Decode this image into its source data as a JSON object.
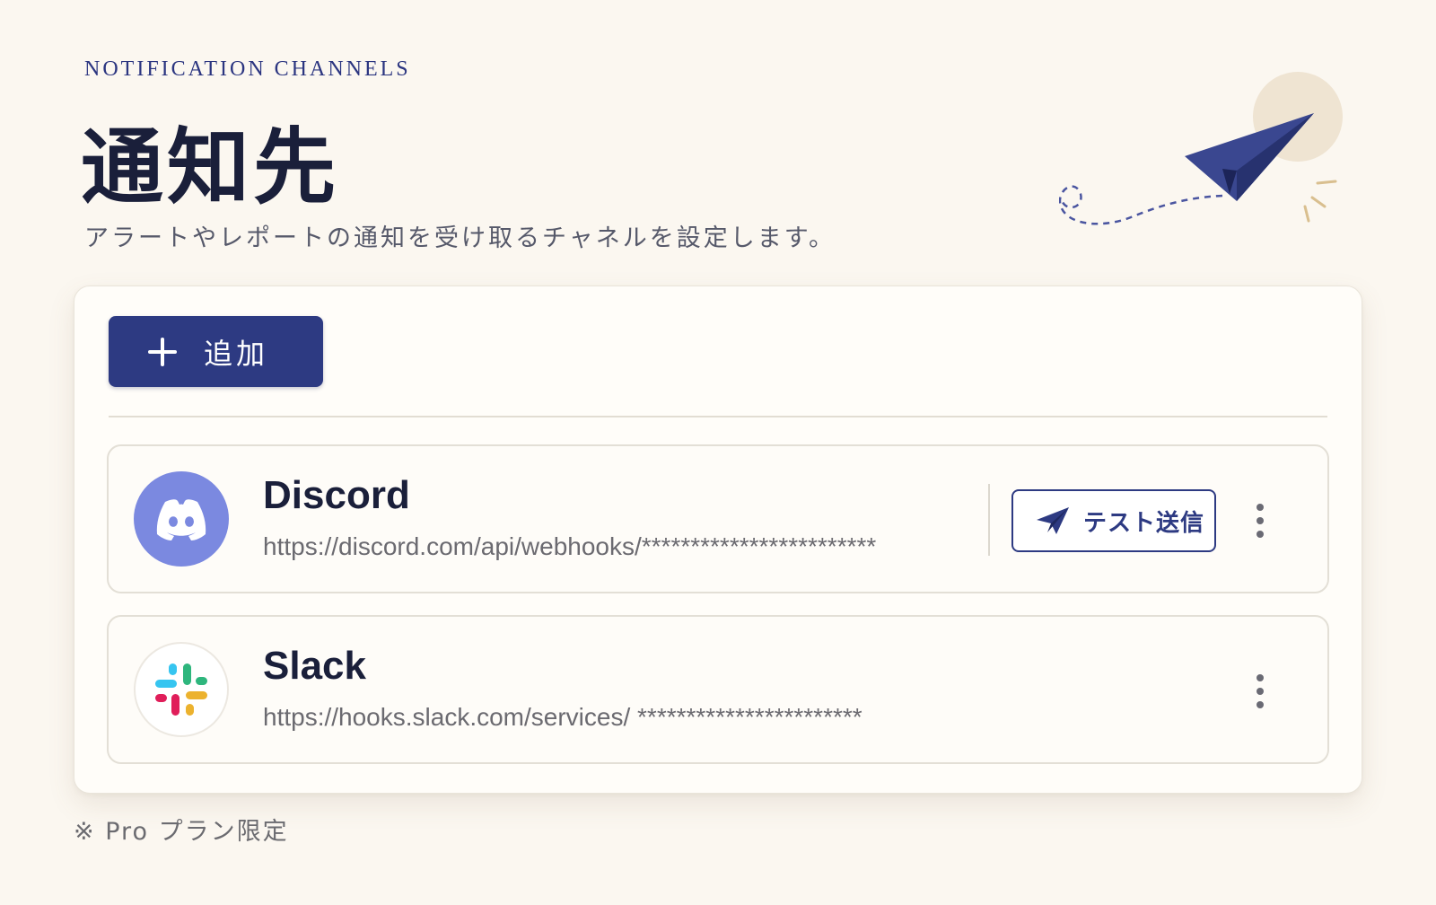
{
  "header": {
    "eyebrow": "NOTIFICATION CHANNELS",
    "title": "通知先",
    "subtitle": "アラートやレポートの通知を受け取るチャネルを設定します。"
  },
  "toolbar": {
    "add_label": "追加"
  },
  "channels": [
    {
      "name": "Discord",
      "url": "https://discord.com/api/webhooks/************************",
      "icon": "discord-logo",
      "test_label": "テスト送信"
    },
    {
      "name": "Slack",
      "url": "https://hooks.slack.com/services/ ***********************",
      "icon": "slack-logo"
    }
  ],
  "footer": {
    "note": "※ Pro プラン限定"
  },
  "colors": {
    "accent": "#2d3a82",
    "background": "#fbf7f0",
    "discord": "#7b89e0"
  }
}
